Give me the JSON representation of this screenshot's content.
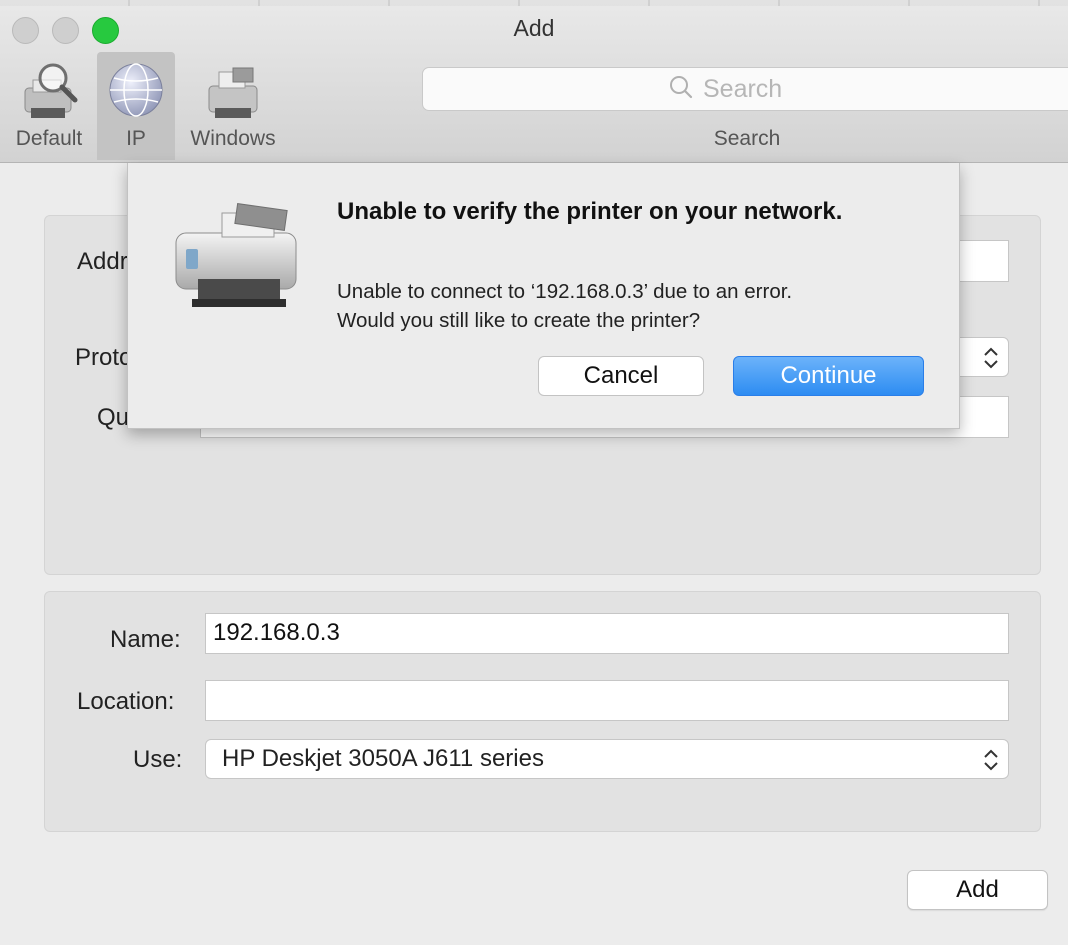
{
  "window": {
    "title": "Add"
  },
  "toolbar": {
    "items": [
      {
        "label": "Default",
        "icon": "printer-search-icon"
      },
      {
        "label": "IP",
        "icon": "globe-icon",
        "selected": true
      },
      {
        "label": "Windows",
        "icon": "printer-icon"
      }
    ],
    "search": {
      "placeholder": "Search",
      "caption": "Search"
    }
  },
  "form_top": {
    "address_label": "Addr",
    "protocol_label": "Proto",
    "queue_label": "Qu"
  },
  "form_bottom": {
    "name_label": "Name:",
    "name_value": "192.168.0.3",
    "location_label": "Location:",
    "location_value": "",
    "use_label": "Use:",
    "use_value": "HP Deskjet 3050A J611 series"
  },
  "add_button": "Add",
  "alert": {
    "title": "Unable to verify the printer on your network.",
    "message_line1": "Unable to connect to ‘192.168.0.3’ due to an error.",
    "message_line2": "Would you still like to create the printer?",
    "cancel_label": "Cancel",
    "continue_label": "Continue"
  },
  "colors": {
    "accent": "#2d8cf2",
    "zoom_button": "#27c93f"
  }
}
